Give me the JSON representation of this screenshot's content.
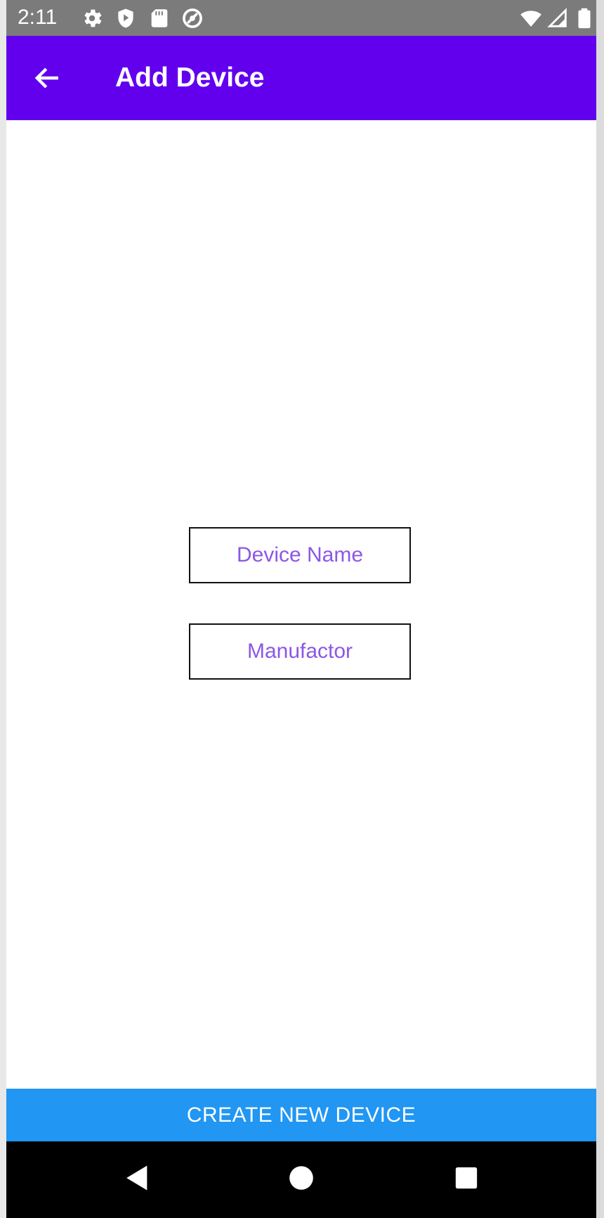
{
  "status_bar": {
    "time": "2:11",
    "icons": [
      "settings-icon",
      "play-protect-icon",
      "sd-card-icon",
      "sync-icon",
      "wifi-icon",
      "signal-icon",
      "battery-icon"
    ]
  },
  "app_bar": {
    "title": "Add Device",
    "back_icon": "arrow-back-icon",
    "background": "#6200ee"
  },
  "form": {
    "device_name": {
      "value": "",
      "placeholder": "Device Name"
    },
    "manufacturer": {
      "value": "",
      "placeholder": "Manufactor"
    }
  },
  "actions": {
    "create_label": "CREATE NEW DEVICE",
    "create_color": "#2196f3"
  },
  "nav_bar": {
    "icons": [
      "back-triangle-icon",
      "home-circle-icon",
      "recents-square-icon"
    ]
  }
}
